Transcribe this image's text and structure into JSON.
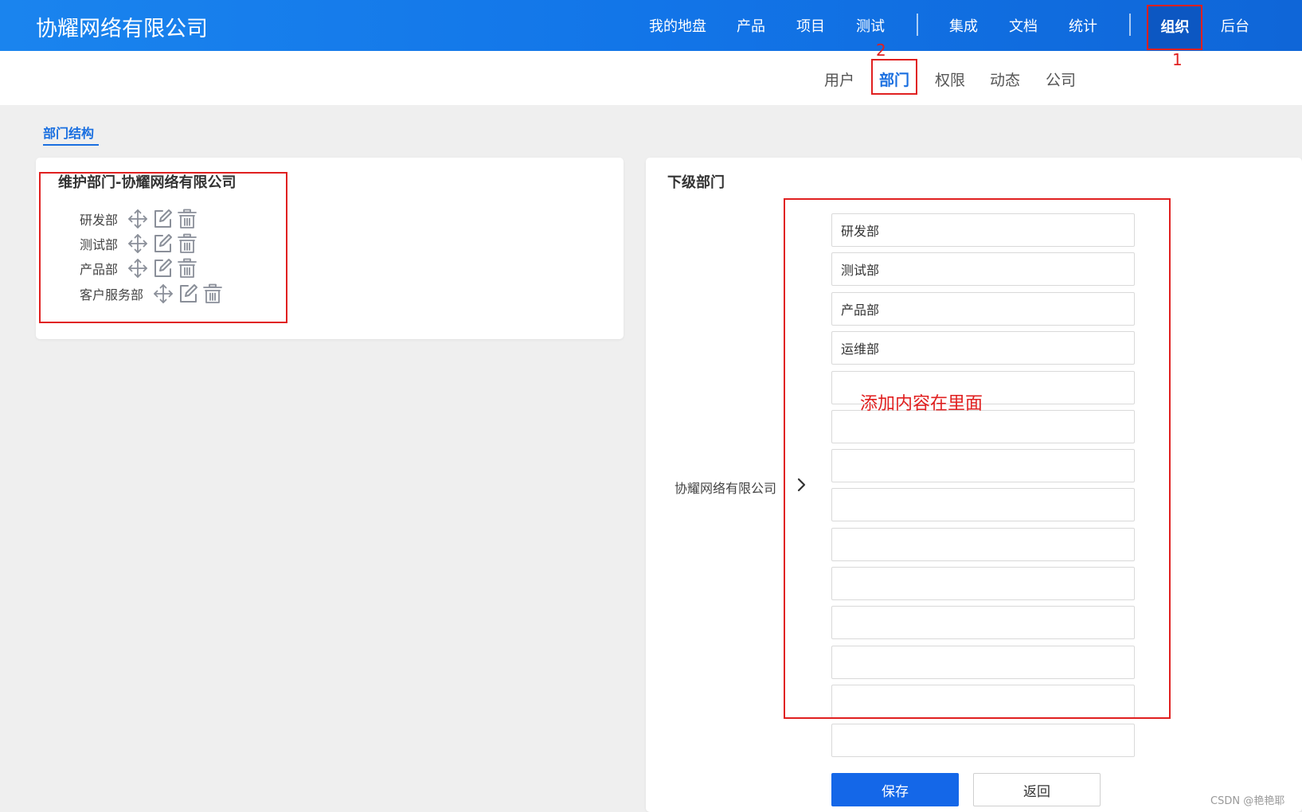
{
  "header": {
    "brand": "协耀网络有限公司",
    "nav": [
      "我的地盘",
      "产品",
      "项目",
      "测试",
      "集成",
      "文档",
      "统计",
      "组织",
      "后台"
    ],
    "active_nav": "组织"
  },
  "subnav": {
    "items": [
      "用户",
      "部门",
      "权限",
      "动态",
      "公司"
    ],
    "active": "部门"
  },
  "annotations": {
    "step1": "1",
    "step2": "2",
    "hint": "添加内容在里面"
  },
  "page_tab": "部门结构",
  "left_panel": {
    "title": "维护部门-协耀网络有限公司",
    "departments": [
      {
        "name": "研发部",
        "icons": [
          "move-icon",
          "edit-icon",
          "delete-icon"
        ]
      },
      {
        "name": "测试部",
        "icons": [
          "move-icon",
          "edit-icon",
          "delete-icon"
        ]
      },
      {
        "name": "产品部",
        "icons": [
          "move-icon",
          "edit-icon",
          "delete-icon"
        ]
      },
      {
        "name": "客户服务部",
        "icons": [
          "move-icon",
          "edit-icon",
          "delete-icon"
        ]
      }
    ]
  },
  "right_panel": {
    "title": "下级部门",
    "parent_company": "协耀网络有限公司",
    "inputs": [
      "研发部",
      "测试部",
      "产品部",
      "运维部",
      "",
      "",
      "",
      "",
      "",
      "",
      "",
      "",
      "",
      ""
    ],
    "save_label": "保存",
    "back_label": "返回"
  },
  "watermark": "CSDN @艳艳耶",
  "colors": {
    "topbar": "#1275e8",
    "active_nav_bg": "#0c57c2",
    "accent": "#1a6fe0",
    "annotation_red": "#e02020",
    "save_button": "#1467e8"
  }
}
